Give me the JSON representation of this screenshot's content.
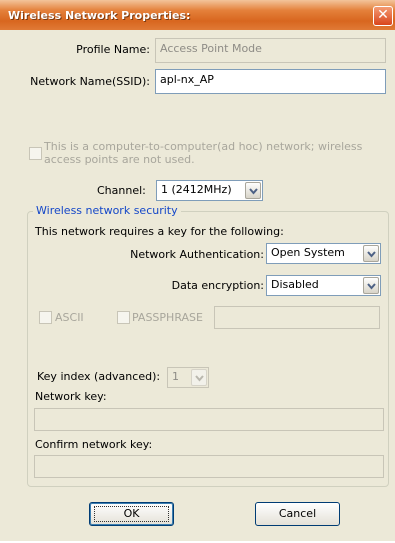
{
  "window": {
    "title": "Wireless Network Properties:",
    "close_glyph": "✕"
  },
  "profile": {
    "label": "Profile Name:",
    "value": "Access Point Mode"
  },
  "ssid": {
    "label": "Network Name(SSID):",
    "value": "apl-nx_AP"
  },
  "adhoc": {
    "line1": "This is a computer-to-computer(ad hoc) network; wireless",
    "line2": "access points are not used."
  },
  "channel": {
    "label": "Channel:",
    "value": "1  (2412MHz)"
  },
  "security": {
    "group_title": "Wireless network security",
    "requires_text": "This network requires a key for the following:",
    "auth_label": "Network Authentication:",
    "auth_value": "Open System",
    "enc_label": "Data encryption:",
    "enc_value": "Disabled",
    "ascii_label": "ASCII",
    "passphrase_label": "PASSPHRASE",
    "key_index_label": "Key index (advanced):",
    "key_index_value": "1",
    "network_key_label": "Network key:",
    "confirm_key_label": "Confirm network key:"
  },
  "buttons": {
    "ok": "OK",
    "cancel": "Cancel"
  },
  "colors": {
    "title_gradient": "#e4803a",
    "group_title": "#1447c8",
    "window_bg": "#ece9d8"
  }
}
